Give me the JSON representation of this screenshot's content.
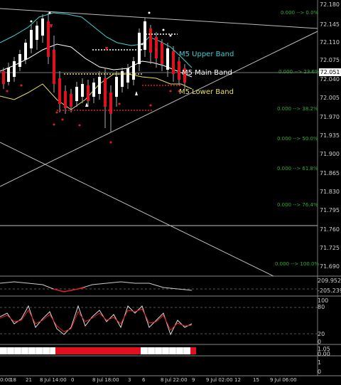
{
  "price_axis": {
    "labels": [
      "72.180",
      "72.145",
      "72.110",
      "72.075",
      "72.040",
      "72.005",
      "71.970",
      "71.935",
      "71.900",
      "71.865",
      "71.830",
      "71.795",
      "71.760",
      "71.725",
      "71.690"
    ],
    "current_price": "72.051"
  },
  "fibonacci": {
    "levels": [
      "0.000 --> 0.0%",
      "0.000 --> 23.6%",
      "0.000 --> 38.2%",
      "0.000 --> 50.0%",
      "0.000 --> 61.8%",
      "0.000 --> 76.4%",
      "0.000 --> 100.0%"
    ]
  },
  "bands": {
    "upper": "M5 Upper Band",
    "main": "M5 Main Band",
    "lower": "M5 Lower Band"
  },
  "indicator_panel1": {
    "top": "209.9527",
    "bottom": "-205.2394"
  },
  "indicator_panel2": {
    "top": "100",
    "mid": "80",
    "low": "20",
    "bottom": "0"
  },
  "indicator_panel3": {
    "top": "1.05",
    "bottom": "0.00"
  },
  "indicator_panel4": {
    "top": "1",
    "bottom": "0"
  },
  "time_axis": [
    "0:00",
    "18",
    "21",
    "8 Jul 14:00",
    "0",
    "8 Jul 18:00",
    "3",
    "6",
    "8 Jul 22:00",
    "9",
    "9 Jul 02:00",
    "12",
    "15",
    "9 Jul 06:00"
  ],
  "colors": {
    "upper_band": "#3fd0d0",
    "main_band": "#ffffff",
    "lower_band": "#e6e060",
    "fib_text": "#2fae2f",
    "signal_red": "#e02020",
    "bar_red": "#e01020"
  }
}
